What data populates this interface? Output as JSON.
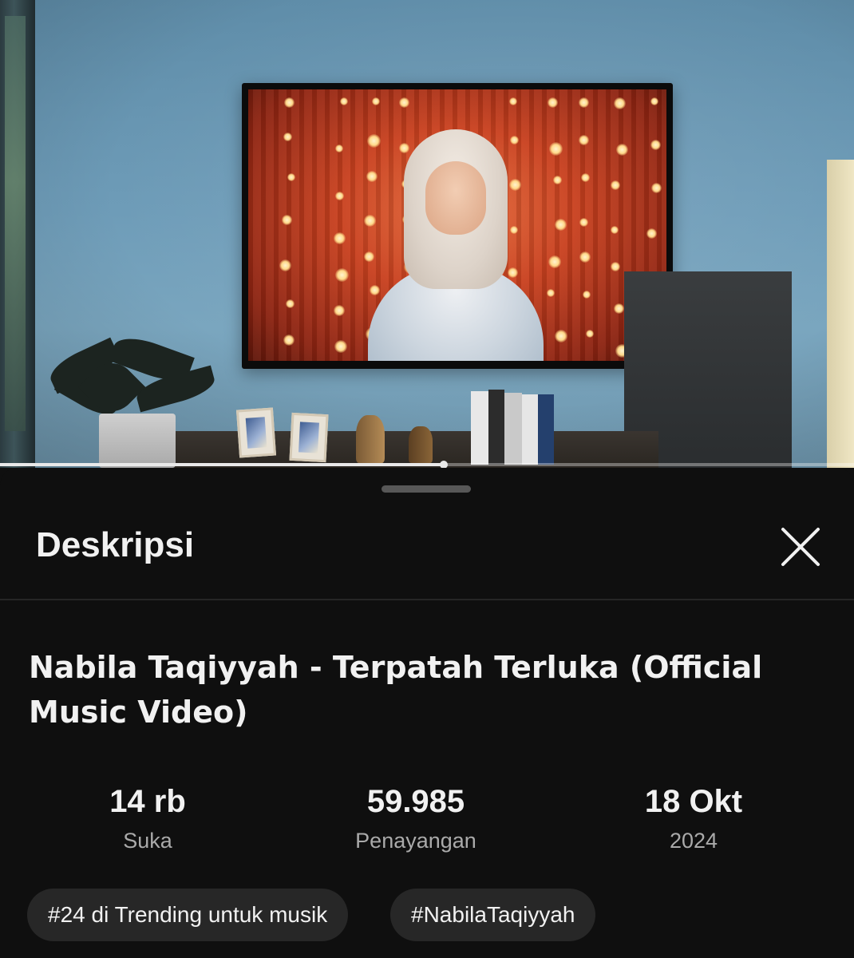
{
  "player": {
    "progress": 0.52
  },
  "description_panel": {
    "header_title": "Deskripsi",
    "close_icon": "close-icon",
    "video_title": "Nabila Taqiyyah - Terpatah Terluka (Official Music Video)",
    "stats": [
      {
        "value": "14 rb",
        "label": "Suka"
      },
      {
        "value": "59.985",
        "label": "Penayangan"
      },
      {
        "value": "18 Okt",
        "label": "2024"
      }
    ],
    "chips": [
      {
        "label": "#24 di Trending untuk musik"
      },
      {
        "label": "#NabilaTaqiyyah"
      }
    ]
  },
  "colors": {
    "background": "#0f0f0f",
    "chip_background": "#272727",
    "text_primary": "#f1f1f1",
    "text_secondary": "#aaaaaa"
  }
}
